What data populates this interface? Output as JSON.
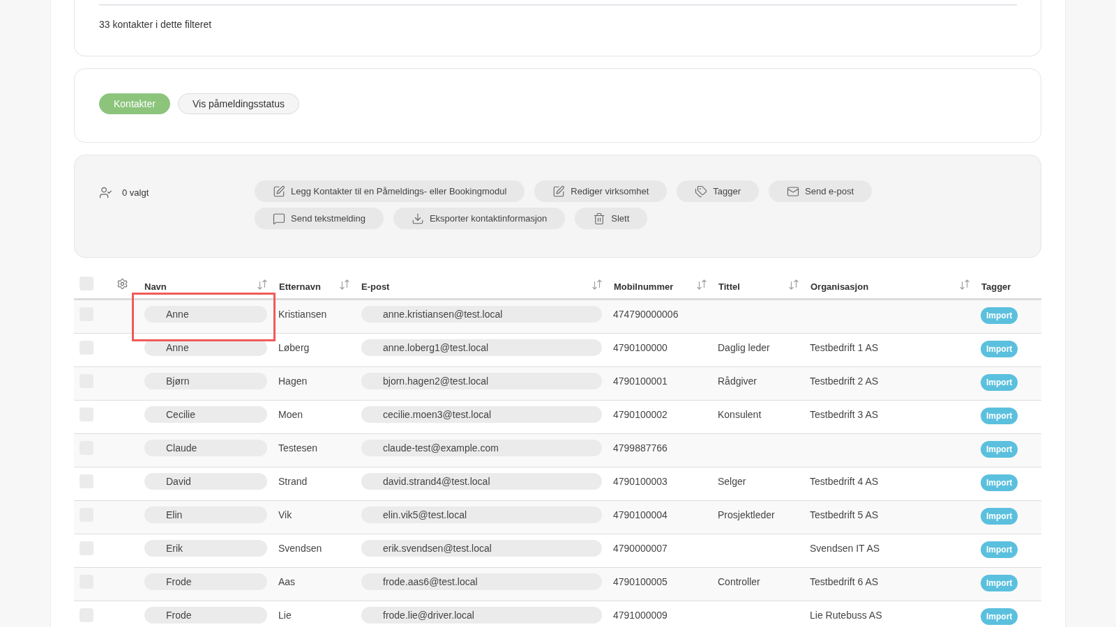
{
  "filter_summary": {
    "count_text": "33 kontakter i dette filteret"
  },
  "view_tabs": [
    {
      "label": "Kontakter",
      "selected": true
    },
    {
      "label": "Vis påmeldingsstatus",
      "selected": false
    }
  ],
  "bulk_actions": {
    "selected_count": "0 valgt",
    "buttons": [
      "Legg Kontakter til en Påmeldings- eller Bookingmodul",
      "Rediger virksomhet",
      "Tagger",
      "Send e-post",
      "Send tekstmelding",
      "Eksporter kontaktinformasjon",
      "Slett"
    ]
  },
  "table": {
    "select_all": {
      "checked": false
    },
    "columns": [
      {
        "label": "Navn",
        "kind": "pill",
        "sortable": true
      },
      {
        "label": "Etternavn",
        "kind": "text",
        "sortable": true
      },
      {
        "label": "E-post",
        "kind": "pill",
        "sortable": true
      },
      {
        "label": "Mobilnummer",
        "kind": "text",
        "sortable": true
      },
      {
        "label": "Tittel",
        "kind": "text",
        "sortable": true
      },
      {
        "label": "Organisasjon",
        "kind": "text",
        "sortable": true
      },
      {
        "label": "Tagger",
        "kind": "tags",
        "sortable": false
      }
    ],
    "rows": [
      {
        "checked": false,
        "highlighted": true,
        "first_name": "Anne",
        "last_name": "Kristiansen",
        "email": "anne.kristiansen@test.local",
        "mobile": "474790000006",
        "tags": [
          "Import"
        ]
      },
      {
        "checked": false,
        "highlighted": false,
        "first_name": "Anne",
        "last_name": "Løberg",
        "email": "anne.loberg1@test.local",
        "mobile": "4790100000",
        "title": "Daglig leder",
        "organisation": "Testbedrift 1 AS",
        "tags": [
          "Import"
        ]
      },
      {
        "checked": false,
        "highlighted": false,
        "first_name": "Bjørn",
        "last_name": "Hagen",
        "email": "bjorn.hagen2@test.local",
        "mobile": "4790100001",
        "title": "Rådgiver",
        "organisation": "Testbedrift 2 AS",
        "tags": [
          "Import"
        ]
      },
      {
        "checked": false,
        "highlighted": false,
        "first_name": "Cecilie",
        "last_name": "Moen",
        "email": "cecilie.moen3@test.local",
        "mobile": "4790100002",
        "title": "Konsulent",
        "organisation": "Testbedrift 3 AS",
        "tags": [
          "Import"
        ]
      },
      {
        "checked": false,
        "highlighted": false,
        "first_name": "Claude",
        "last_name": "Testesen",
        "email": "claude-test@example.com",
        "mobile": "4799887766",
        "tags": [
          "Import"
        ]
      },
      {
        "checked": false,
        "highlighted": false,
        "first_name": "David",
        "last_name": "Strand",
        "email": "david.strand4@test.local",
        "mobile": "4790100003",
        "title": "Selger",
        "organisation": "Testbedrift 4 AS",
        "tags": [
          "Import"
        ]
      },
      {
        "checked": false,
        "highlighted": false,
        "first_name": "Elin",
        "last_name": "Vik",
        "email": "elin.vik5@test.local",
        "mobile": "4790100004",
        "title": "Prosjektleder",
        "organisation": "Testbedrift 5 AS",
        "tags": [
          "Import"
        ]
      },
      {
        "checked": false,
        "highlighted": false,
        "first_name": "Erik",
        "last_name": "Svendsen",
        "email": "erik.svendsen@test.local",
        "mobile": "4790000007",
        "organisation": "Svendsen IT AS",
        "tags": [
          "Import"
        ]
      },
      {
        "checked": false,
        "highlighted": false,
        "first_name": "Frode",
        "last_name": "Aas",
        "email": "frode.aas6@test.local",
        "mobile": "4790100005",
        "title": "Controller",
        "organisation": "Testbedrift 6 AS",
        "tags": [
          "Import"
        ]
      },
      {
        "checked": false,
        "highlighted": false,
        "first_name": "Frode",
        "last_name": "Lie",
        "email": "frode.lie@driver.local",
        "mobile": "4791000009",
        "organisation": "Lie Rutebuss AS",
        "tags": [
          "Import"
        ]
      }
    ]
  }
}
